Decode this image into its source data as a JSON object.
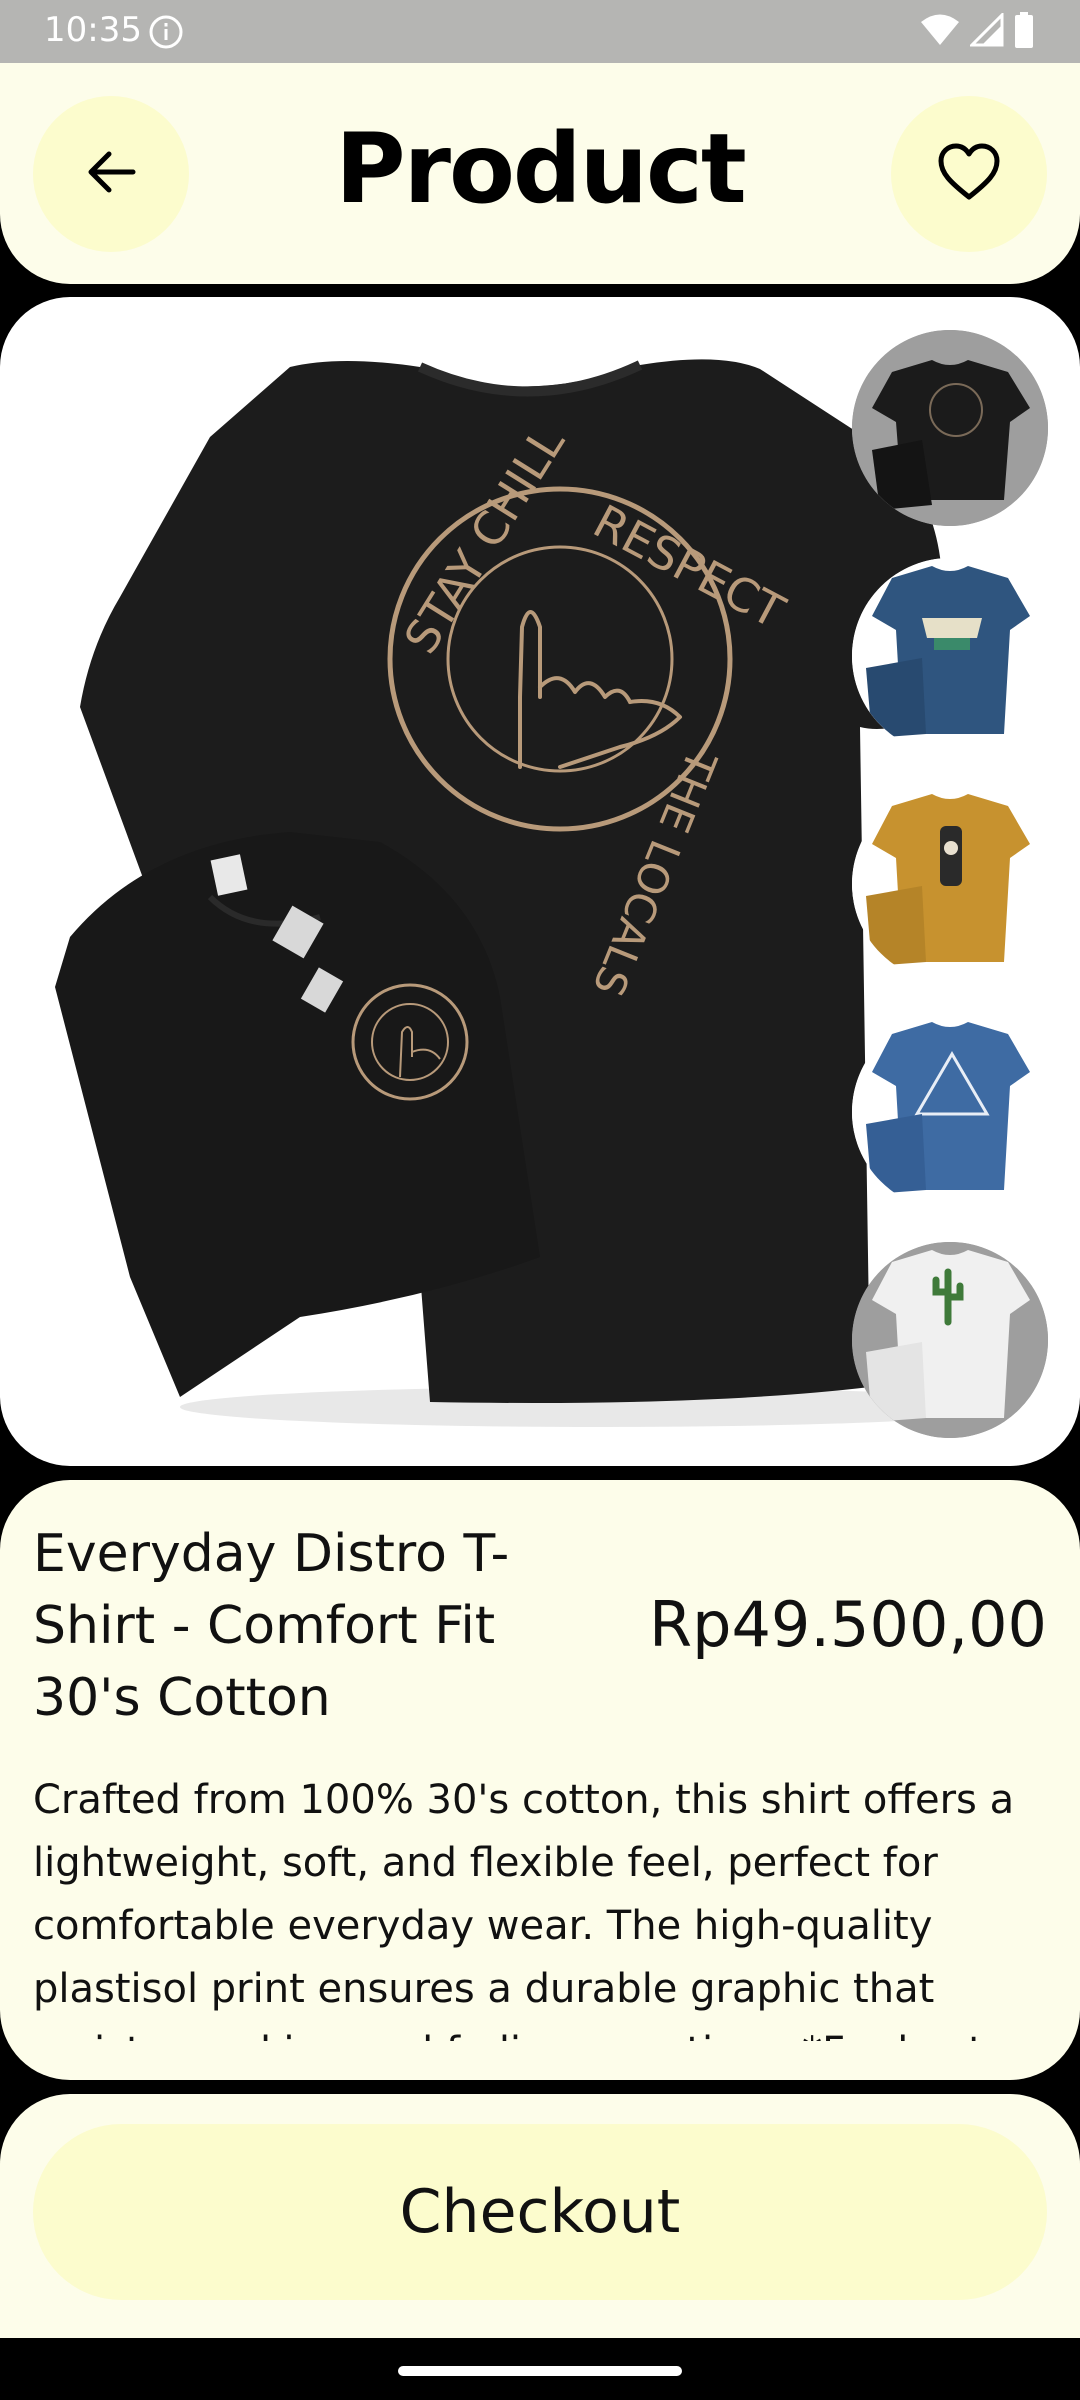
{
  "status_bar": {
    "time": "10:35",
    "icons": [
      "info-icon",
      "wifi-icon",
      "signal-icon",
      "battery-icon"
    ]
  },
  "header": {
    "title": "Product",
    "back_icon": "arrow-left-icon",
    "favorite_icon": "heart-outline-icon"
  },
  "gallery": {
    "main_image": "black t-shirt with 'Stay Chill Respect The Locals' shaka hand print",
    "main_print": {
      "top_left": "STAY CHILL",
      "top_right": "RESPECT",
      "bottom": "THE LOCALS"
    },
    "thumbnails": [
      {
        "color": "#1b1b1b",
        "background": "#9e9e9e",
        "selected": true
      },
      {
        "color": "#2f557f",
        "background": "#ffffff",
        "selected": false
      },
      {
        "color": "#c7922f",
        "background": "#ffffff",
        "selected": false
      },
      {
        "color": "#3e6ba3",
        "background": "#ffffff",
        "selected": false
      },
      {
        "color": "#f0f0f0",
        "background": "#9e9e9e",
        "selected": false
      }
    ]
  },
  "product": {
    "name": "Everyday Distro T-Shirt - Comfort Fit 30's Cotton",
    "price": "Rp49.500,00",
    "description": "Crafted from 100% 30's cotton, this shirt offers a lightweight, soft, and flexible feel, perfect for comfortable everyday wear. The high-quality plastisol print ensures a durable graphic that resists cracking and fading over time. *For best care"
  },
  "checkout": {
    "label": "Checkout"
  },
  "colors": {
    "panel": "#fdfdea",
    "button": "#fcfccd",
    "print": "#b89a7a"
  }
}
